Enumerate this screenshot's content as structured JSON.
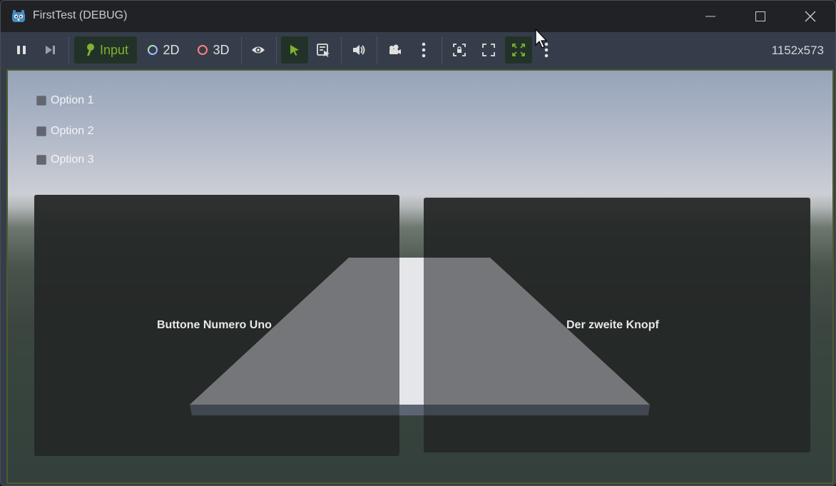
{
  "window": {
    "title": "FirstTest (DEBUG)",
    "icon": "godot-icon",
    "controls": [
      "minimize-icon",
      "maximize-icon",
      "close-icon"
    ]
  },
  "toolbar": {
    "pause_icon": "pause-icon",
    "next_frame_icon": "next-frame-icon",
    "input_label": "Input",
    "mode_2d_label": "2D",
    "mode_3d_label": "3D",
    "visibility_icon": "eye-icon",
    "select_icon": "cursor-select-icon",
    "list_select_icon": "list-select-icon",
    "audio_icon": "speaker-icon",
    "camera_icon": "camera-icon",
    "more_icon": "kebab-menu-icon",
    "aspect_icon": "lock-aspect-icon",
    "fullscreen_icon": "fullscreen-icon",
    "embed_icon": "expand-icon",
    "more2_icon": "kebab-menu-icon",
    "resolution": "1152x573",
    "colors": {
      "active_bg": "#233228",
      "input_accent": "#7eb32e",
      "select_accent": "#7eb32e",
      "ring_2d": "#8fd0ff",
      "ring_3d": "#ff8080"
    }
  },
  "game": {
    "options": [
      {
        "label": "Option 1"
      },
      {
        "label": "Option 2"
      },
      {
        "label": "Option 3"
      }
    ],
    "left_button_label": "Buttone Numero Uno",
    "right_button_label": "Der zweite Knopf"
  }
}
